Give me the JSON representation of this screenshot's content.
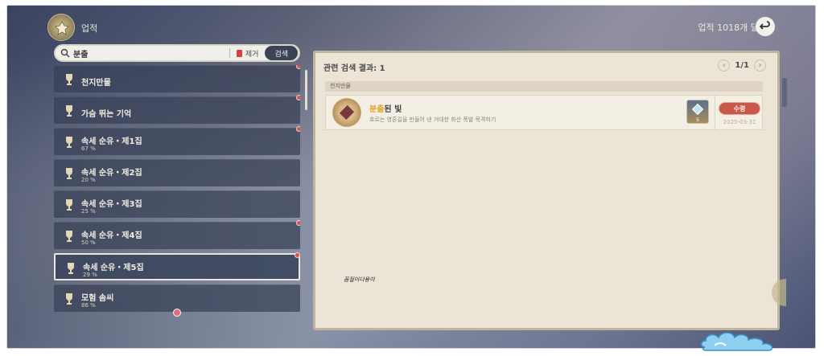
{
  "header": {
    "title": "업적",
    "count_text": "업적 1018개 달성"
  },
  "search": {
    "query": "분출",
    "clear_label": "제거",
    "search_label": "검색"
  },
  "categories": [
    {
      "name": "천지만물",
      "pct": ""
    },
    {
      "name": "가슴 뛰는 기억",
      "pct": ""
    },
    {
      "name": "속세 순유・제1집",
      "pct": "67 %"
    },
    {
      "name": "속세 순유・제2집",
      "pct": "20 %"
    },
    {
      "name": "속세 순유・제3집",
      "pct": "25 %"
    },
    {
      "name": "속세 순유・제4집",
      "pct": "50 %"
    },
    {
      "name": "속세 순유・제5집",
      "pct": "29 %"
    },
    {
      "name": "모험 솜씨",
      "pct": "86 %"
    }
  ],
  "results": {
    "header": "관련 검색 결과: 1",
    "page": "1/1",
    "category": "천지만물",
    "achievement": {
      "title_highlight": "분출",
      "title_rest": "된 빛",
      "description": "흐르는 영혼길을 만들어 낸 거대한 화산 폭발 목격하기",
      "reward_count": "5",
      "claim_label": "수령",
      "date": "2025-03-31"
    }
  },
  "signature": "꼼질이다용이"
}
